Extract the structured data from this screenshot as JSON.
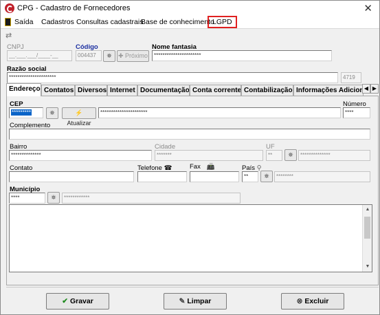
{
  "window": {
    "title": "CPG - Cadastro de Fornecedores"
  },
  "menu": {
    "items": [
      "Saída",
      "Cadastros",
      "Consultas cadastrais",
      "Base de conhecimento",
      "LGPD"
    ]
  },
  "header": {
    "cnpj_label": "CNPJ",
    "cnpj_value": "__.___.___/____-__",
    "codigo_label": "Código",
    "codigo_value": "004437",
    "proximo_label": "Próximo",
    "nome_fantasia_label": "Nome fantasia",
    "nome_fantasia_value": "**********************",
    "razao_social_label": "Razão social",
    "razao_social_value": "**********************",
    "razao_code": "4719"
  },
  "tabs": [
    "Endereço",
    "Contatos",
    "Diversos",
    "Internet",
    "Documentação",
    "Conta corrente",
    "Contabilização",
    "Informações Adiciona"
  ],
  "address": {
    "cep_label": "CEP",
    "cep_value": "*********",
    "atualizar_label": "Atualizar",
    "logradouro_value": "**********************",
    "numero_label": "Número",
    "numero_value": "****",
    "complemento_label": "Complemento",
    "bairro_label": "Bairro",
    "bairro_value": "**************",
    "cidade_label": "Cidade",
    "cidade_value": "*******",
    "uf_label": "UF",
    "uf_value": "**",
    "uf_desc_value": "**************",
    "contato_label": "Contato",
    "telefone_label": "Telefone",
    "fax_label": "Fax",
    "pais_label": "País",
    "pais_value": "**",
    "pais_desc_value": "********",
    "municipio_label": "Município",
    "municipio_value": "****",
    "municipio_desc_value": "************"
  },
  "footer": {
    "gravar": "Gravar",
    "limpar": "Limpar",
    "excluir": "Excluir"
  }
}
